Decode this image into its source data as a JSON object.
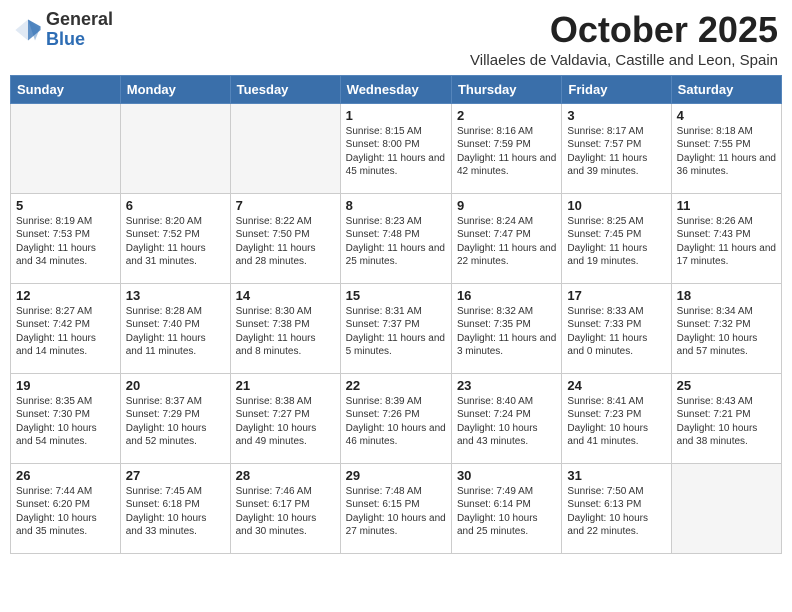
{
  "logo": {
    "general": "General",
    "blue": "Blue"
  },
  "title": "October 2025",
  "location": "Villaeles de Valdavia, Castille and Leon, Spain",
  "weekdays": [
    "Sunday",
    "Monday",
    "Tuesday",
    "Wednesday",
    "Thursday",
    "Friday",
    "Saturday"
  ],
  "weeks": [
    [
      {
        "day": "",
        "sunrise": "",
        "sunset": "",
        "daylight": ""
      },
      {
        "day": "",
        "sunrise": "",
        "sunset": "",
        "daylight": ""
      },
      {
        "day": "",
        "sunrise": "",
        "sunset": "",
        "daylight": ""
      },
      {
        "day": "1",
        "sunrise": "Sunrise: 8:15 AM",
        "sunset": "Sunset: 8:00 PM",
        "daylight": "Daylight: 11 hours and 45 minutes."
      },
      {
        "day": "2",
        "sunrise": "Sunrise: 8:16 AM",
        "sunset": "Sunset: 7:59 PM",
        "daylight": "Daylight: 11 hours and 42 minutes."
      },
      {
        "day": "3",
        "sunrise": "Sunrise: 8:17 AM",
        "sunset": "Sunset: 7:57 PM",
        "daylight": "Daylight: 11 hours and 39 minutes."
      },
      {
        "day": "4",
        "sunrise": "Sunrise: 8:18 AM",
        "sunset": "Sunset: 7:55 PM",
        "daylight": "Daylight: 11 hours and 36 minutes."
      }
    ],
    [
      {
        "day": "5",
        "sunrise": "Sunrise: 8:19 AM",
        "sunset": "Sunset: 7:53 PM",
        "daylight": "Daylight: 11 hours and 34 minutes."
      },
      {
        "day": "6",
        "sunrise": "Sunrise: 8:20 AM",
        "sunset": "Sunset: 7:52 PM",
        "daylight": "Daylight: 11 hours and 31 minutes."
      },
      {
        "day": "7",
        "sunrise": "Sunrise: 8:22 AM",
        "sunset": "Sunset: 7:50 PM",
        "daylight": "Daylight: 11 hours and 28 minutes."
      },
      {
        "day": "8",
        "sunrise": "Sunrise: 8:23 AM",
        "sunset": "Sunset: 7:48 PM",
        "daylight": "Daylight: 11 hours and 25 minutes."
      },
      {
        "day": "9",
        "sunrise": "Sunrise: 8:24 AM",
        "sunset": "Sunset: 7:47 PM",
        "daylight": "Daylight: 11 hours and 22 minutes."
      },
      {
        "day": "10",
        "sunrise": "Sunrise: 8:25 AM",
        "sunset": "Sunset: 7:45 PM",
        "daylight": "Daylight: 11 hours and 19 minutes."
      },
      {
        "day": "11",
        "sunrise": "Sunrise: 8:26 AM",
        "sunset": "Sunset: 7:43 PM",
        "daylight": "Daylight: 11 hours and 17 minutes."
      }
    ],
    [
      {
        "day": "12",
        "sunrise": "Sunrise: 8:27 AM",
        "sunset": "Sunset: 7:42 PM",
        "daylight": "Daylight: 11 hours and 14 minutes."
      },
      {
        "day": "13",
        "sunrise": "Sunrise: 8:28 AM",
        "sunset": "Sunset: 7:40 PM",
        "daylight": "Daylight: 11 hours and 11 minutes."
      },
      {
        "day": "14",
        "sunrise": "Sunrise: 8:30 AM",
        "sunset": "Sunset: 7:38 PM",
        "daylight": "Daylight: 11 hours and 8 minutes."
      },
      {
        "day": "15",
        "sunrise": "Sunrise: 8:31 AM",
        "sunset": "Sunset: 7:37 PM",
        "daylight": "Daylight: 11 hours and 5 minutes."
      },
      {
        "day": "16",
        "sunrise": "Sunrise: 8:32 AM",
        "sunset": "Sunset: 7:35 PM",
        "daylight": "Daylight: 11 hours and 3 minutes."
      },
      {
        "day": "17",
        "sunrise": "Sunrise: 8:33 AM",
        "sunset": "Sunset: 7:33 PM",
        "daylight": "Daylight: 11 hours and 0 minutes."
      },
      {
        "day": "18",
        "sunrise": "Sunrise: 8:34 AM",
        "sunset": "Sunset: 7:32 PM",
        "daylight": "Daylight: 10 hours and 57 minutes."
      }
    ],
    [
      {
        "day": "19",
        "sunrise": "Sunrise: 8:35 AM",
        "sunset": "Sunset: 7:30 PM",
        "daylight": "Daylight: 10 hours and 54 minutes."
      },
      {
        "day": "20",
        "sunrise": "Sunrise: 8:37 AM",
        "sunset": "Sunset: 7:29 PM",
        "daylight": "Daylight: 10 hours and 52 minutes."
      },
      {
        "day": "21",
        "sunrise": "Sunrise: 8:38 AM",
        "sunset": "Sunset: 7:27 PM",
        "daylight": "Daylight: 10 hours and 49 minutes."
      },
      {
        "day": "22",
        "sunrise": "Sunrise: 8:39 AM",
        "sunset": "Sunset: 7:26 PM",
        "daylight": "Daylight: 10 hours and 46 minutes."
      },
      {
        "day": "23",
        "sunrise": "Sunrise: 8:40 AM",
        "sunset": "Sunset: 7:24 PM",
        "daylight": "Daylight: 10 hours and 43 minutes."
      },
      {
        "day": "24",
        "sunrise": "Sunrise: 8:41 AM",
        "sunset": "Sunset: 7:23 PM",
        "daylight": "Daylight: 10 hours and 41 minutes."
      },
      {
        "day": "25",
        "sunrise": "Sunrise: 8:43 AM",
        "sunset": "Sunset: 7:21 PM",
        "daylight": "Daylight: 10 hours and 38 minutes."
      }
    ],
    [
      {
        "day": "26",
        "sunrise": "Sunrise: 7:44 AM",
        "sunset": "Sunset: 6:20 PM",
        "daylight": "Daylight: 10 hours and 35 minutes."
      },
      {
        "day": "27",
        "sunrise": "Sunrise: 7:45 AM",
        "sunset": "Sunset: 6:18 PM",
        "daylight": "Daylight: 10 hours and 33 minutes."
      },
      {
        "day": "28",
        "sunrise": "Sunrise: 7:46 AM",
        "sunset": "Sunset: 6:17 PM",
        "daylight": "Daylight: 10 hours and 30 minutes."
      },
      {
        "day": "29",
        "sunrise": "Sunrise: 7:48 AM",
        "sunset": "Sunset: 6:15 PM",
        "daylight": "Daylight: 10 hours and 27 minutes."
      },
      {
        "day": "30",
        "sunrise": "Sunrise: 7:49 AM",
        "sunset": "Sunset: 6:14 PM",
        "daylight": "Daylight: 10 hours and 25 minutes."
      },
      {
        "day": "31",
        "sunrise": "Sunrise: 7:50 AM",
        "sunset": "Sunset: 6:13 PM",
        "daylight": "Daylight: 10 hours and 22 minutes."
      },
      {
        "day": "",
        "sunrise": "",
        "sunset": "",
        "daylight": ""
      }
    ]
  ]
}
